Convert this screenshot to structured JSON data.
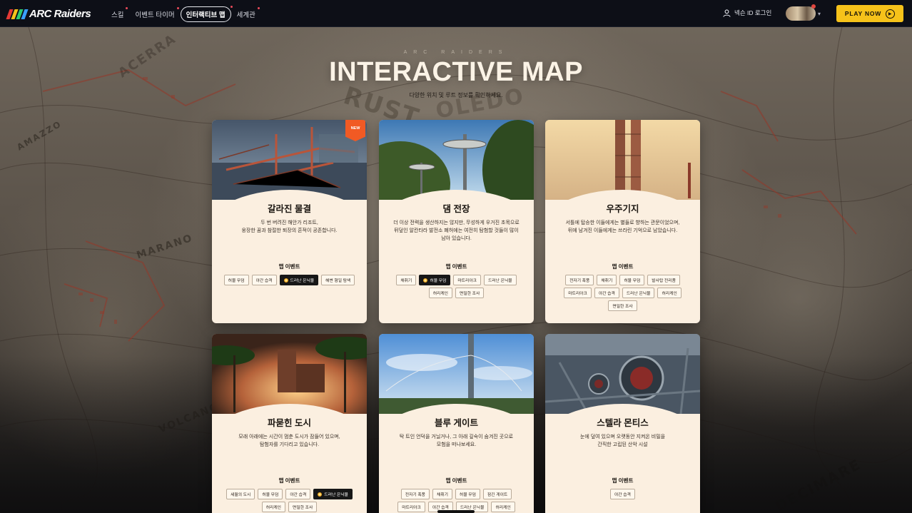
{
  "nav": {
    "logo_text": "ARC Raiders",
    "logo_colors": [
      "#e53935",
      "#f6c21a",
      "#2ecc71",
      "#3aa0ff"
    ],
    "menu": [
      {
        "label": "스킬",
        "active": false,
        "dot": true
      },
      {
        "label": "이벤트 타이머",
        "active": false,
        "dot": true
      },
      {
        "label": "인터랙티브 맵",
        "active": true,
        "dot": true
      },
      {
        "label": "세계관",
        "active": false,
        "dot": true
      }
    ],
    "login_label": "넥슨 ID 로그인",
    "play_label": "PLAY NOW"
  },
  "hero": {
    "kicker": "ARC RAIDERS",
    "title": "INTERACTIVE MAP",
    "subtitle": "다양한 위치 및 루트 정보를 확인하세요."
  },
  "map_labels": [
    "RUST",
    "OLEDO",
    "MARANO",
    "VOLCANO",
    "DECIMARE",
    "ACERRA",
    "AMAZZO"
  ],
  "cards": [
    {
      "title": "갈라진 물결",
      "badge": "NEW",
      "desc_lines": [
        "두 번 버려진 해안가 리조트,",
        "웅장한 꿈과 참절한 퇴장의 흔적이 공존합니다."
      ],
      "events_label": "맵 이벤트",
      "tags": [
        {
          "label": "허물 무덤",
          "hot": false
        },
        {
          "label": "야간 습격",
          "hot": false
        },
        {
          "label": "드러난 은닉물",
          "hot": true
        },
        {
          "label": "해변 형일 탐색",
          "hot": false
        }
      ],
      "theme": "pier"
    },
    {
      "title": "댐 전장",
      "badge": "",
      "desc_lines": [
        "더 이상 전력을 생산하지는 않지만, 무성하게 우거진 초목으로",
        "뒤덮인 알칸타라 발전소 폐허에는 여전히 탐험할 것들이 많이",
        "남아 있습니다."
      ],
      "events_label": "맵 이벤트",
      "tags": [
        {
          "label": "채취기",
          "hot": false
        },
        {
          "label": "허물 무덤",
          "hot": true
        },
        {
          "label": "마트리아크",
          "hot": false
        },
        {
          "label": "드러난 은닉물",
          "hot": false
        },
        {
          "label": "허리케인",
          "hot": false
        },
        {
          "label": "면밀한 조사",
          "hot": false
        }
      ],
      "theme": "dam"
    },
    {
      "title": "우주기지",
      "badge": "",
      "desc_lines": [
        "서틀에 탑승한 이들에게는 별들로 향하는 관문이었으며,",
        "뒤에 남겨진 이들에게는 쓰라린 기억으로 남았습니다."
      ],
      "events_label": "맵 이벤트",
      "tags": [
        {
          "label": "전자기 폭풍",
          "hot": false
        },
        {
          "label": "채취기",
          "hot": false
        },
        {
          "label": "허물 무덤",
          "hot": false
        },
        {
          "label": "발사탑 전리품",
          "hot": false
        },
        {
          "label": "마트리아크",
          "hot": false
        },
        {
          "label": "야간 습격",
          "hot": false
        },
        {
          "label": "드러난 은닉물",
          "hot": false
        },
        {
          "label": "허리케인",
          "hot": false
        },
        {
          "label": "면밀한 조사",
          "hot": false
        }
      ],
      "theme": "spaceport"
    },
    {
      "title": "파묻힌 도시",
      "badge": "",
      "desc_lines": [
        "모래 아래에는 시간이 멈춘 도시가 잠들어 있으며,",
        "탐험자를 기다리고 있습니다."
      ],
      "events_label": "맵 이벤트",
      "tags": [
        {
          "label": "세월의 도시",
          "hot": false
        },
        {
          "label": "허물 무덤",
          "hot": false
        },
        {
          "label": "야간 습격",
          "hot": false
        },
        {
          "label": "드러난 은닉물",
          "hot": true
        },
        {
          "label": "허리케인",
          "hot": false
        },
        {
          "label": "면밀한 조사",
          "hot": false
        }
      ],
      "theme": "buried"
    },
    {
      "title": "블루 게이트",
      "badge": "",
      "desc_lines": [
        "탁 트인 언덕을 거닐거나, 그 아래 깊숙이 숨겨진 곳으로",
        "모험을 떠나보세요."
      ],
      "events_label": "맵 이벤트",
      "tags": [
        {
          "label": "전자기 폭풍",
          "hot": false
        },
        {
          "label": "채취기",
          "hot": false
        },
        {
          "label": "허물 무덤",
          "hot": false
        },
        {
          "label": "잠긴 게이트",
          "hot": false
        },
        {
          "label": "마트리아크",
          "hot": false
        },
        {
          "label": "야간 습격",
          "hot": false
        },
        {
          "label": "드러난 은닉물",
          "hot": false
        },
        {
          "label": "허리케인",
          "hot": false
        }
      ],
      "theme": "bluegate"
    },
    {
      "title": "스텔라 몬티스",
      "badge": "",
      "desc_lines": [
        "눈에 덮여 있으며 오랫동안 지켜온 비밀을",
        "간직한 고립된 산악 시설"
      ],
      "events_label": "맵 이벤트",
      "tags": [
        {
          "label": "야간 습격",
          "hot": false
        }
      ],
      "theme": "stella"
    }
  ]
}
